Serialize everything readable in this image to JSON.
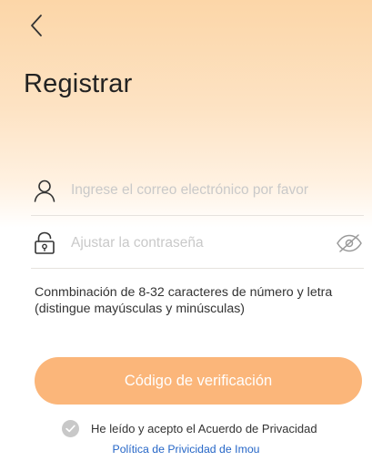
{
  "header": {
    "back_icon": "chevron-left-icon",
    "title": "Registrar"
  },
  "form": {
    "email": {
      "icon": "user-icon",
      "value": "",
      "placeholder": "Ingrese el correo electrónico por favor"
    },
    "password": {
      "icon": "lock-icon",
      "value": "",
      "placeholder": "Ajustar la contraseña",
      "visibility_icon": "eye-off-icon"
    },
    "hint": "Conmbinación de 8-32 caracteres de número y letra (distingue mayúsculas y minúsculas)"
  },
  "actions": {
    "verify_label": "Código de verificación"
  },
  "agreement": {
    "checked": false,
    "text": "He leído y acepto el Acuerdo de Privacidad",
    "link_text": "Política de Privicidad de Imou"
  },
  "colors": {
    "accent": "#fbb67a",
    "link": "#2566c7",
    "header_gradient_top": "#fcd6a8"
  }
}
